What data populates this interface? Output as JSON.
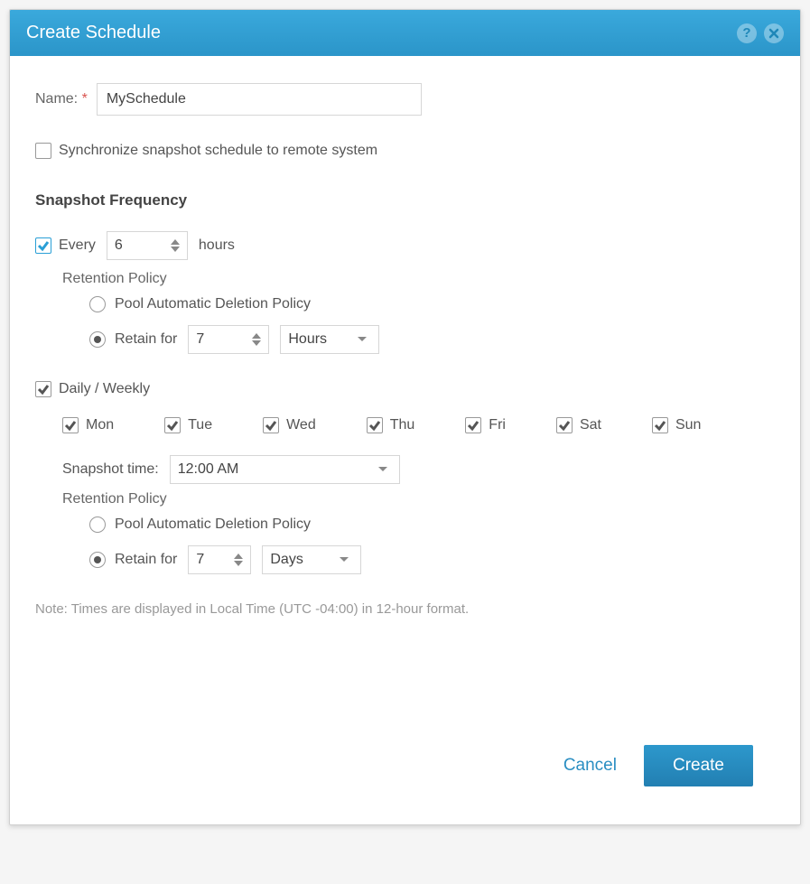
{
  "header": {
    "title": "Create Schedule"
  },
  "form": {
    "name_label": "Name:",
    "name_value": "MySchedule",
    "sync_label": "Synchronize snapshot schedule to remote system",
    "frequency_title": "Snapshot Frequency",
    "every": {
      "label": "Every",
      "value": "6",
      "unit": "hours",
      "retention_label": "Retention Policy",
      "option_pool": "Pool Automatic Deletion Policy",
      "option_retain": "Retain for",
      "retain_value": "7",
      "retain_unit": "Hours"
    },
    "daily": {
      "label": "Daily / Weekly",
      "days": [
        {
          "label": "Mon",
          "checked": true
        },
        {
          "label": "Tue",
          "checked": true
        },
        {
          "label": "Wed",
          "checked": true
        },
        {
          "label": "Thu",
          "checked": true
        },
        {
          "label": "Fri",
          "checked": true
        },
        {
          "label": "Sat",
          "checked": true
        },
        {
          "label": "Sun",
          "checked": true
        }
      ],
      "snapshot_time_label": "Snapshot time:",
      "snapshot_time_value": "12:00 AM",
      "retention_label": "Retention Policy",
      "option_pool": "Pool Automatic Deletion Policy",
      "option_retain": "Retain for",
      "retain_value": "7",
      "retain_unit": "Days"
    },
    "note": "Note: Times are displayed in Local Time (UTC -04:00) in 12-hour format."
  },
  "footer": {
    "cancel": "Cancel",
    "create": "Create"
  }
}
